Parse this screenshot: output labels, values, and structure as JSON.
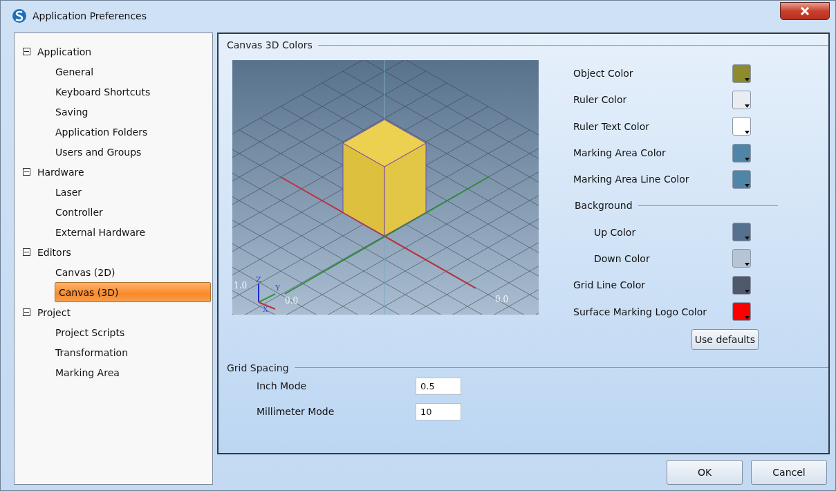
{
  "window": {
    "title": "Application Preferences"
  },
  "tree": [
    {
      "label": "Application",
      "expanded": true,
      "children": [
        {
          "label": "General",
          "selected": false
        },
        {
          "label": "Keyboard Shortcuts",
          "selected": false
        },
        {
          "label": "Saving",
          "selected": false
        },
        {
          "label": "Application Folders",
          "selected": false
        },
        {
          "label": "Users and Groups",
          "selected": false
        }
      ]
    },
    {
      "label": "Hardware",
      "expanded": true,
      "children": [
        {
          "label": "Laser",
          "selected": false
        },
        {
          "label": "Controller",
          "selected": false
        },
        {
          "label": "External Hardware",
          "selected": false
        }
      ]
    },
    {
      "label": "Editors",
      "expanded": true,
      "children": [
        {
          "label": "Canvas (2D)",
          "selected": false
        },
        {
          "label": "Canvas (3D)",
          "selected": true
        }
      ]
    },
    {
      "label": "Project",
      "expanded": true,
      "children": [
        {
          "label": "Project Scripts",
          "selected": false
        },
        {
          "label": "Transformation",
          "selected": false
        },
        {
          "label": "Marking Area",
          "selected": false
        }
      ]
    }
  ],
  "canvas_colors": {
    "title": "Canvas 3D Colors",
    "viewport_labels": [
      "Z",
      "Y",
      "X",
      "1.0",
      "0.0",
      "0.0"
    ],
    "rows": [
      {
        "kind": "color",
        "label": "Object Color",
        "color": "#8f8a2a"
      },
      {
        "kind": "color",
        "label": "Ruler Color",
        "color": "#e9ecf0"
      },
      {
        "kind": "color",
        "label": "Ruler Text Color",
        "color": "#ffffff"
      },
      {
        "kind": "color",
        "label": "Marking Area Color",
        "color": "#4f86a8"
      },
      {
        "kind": "color",
        "label": "Marking Area Line Color",
        "color": "#4f86a8"
      },
      {
        "kind": "heading",
        "label": "Background"
      },
      {
        "kind": "subcolor",
        "label": "Up Color",
        "color": "#56708f"
      },
      {
        "kind": "subcolor",
        "label": "Down Color",
        "color": "#b6c4d6"
      },
      {
        "kind": "color",
        "label": "Grid Line Color",
        "color": "#4e5a6b"
      },
      {
        "kind": "color",
        "label": "Surface Marking Logo Color",
        "color": "#ff0000"
      }
    ],
    "defaults_button": "Use defaults"
  },
  "grid_spacing": {
    "title": "Grid Spacing",
    "fields": [
      {
        "label": "Inch Mode",
        "value": "0.5"
      },
      {
        "label": "Millimeter Mode",
        "value": "10"
      }
    ]
  },
  "buttons": [
    "OK",
    "Cancel"
  ]
}
